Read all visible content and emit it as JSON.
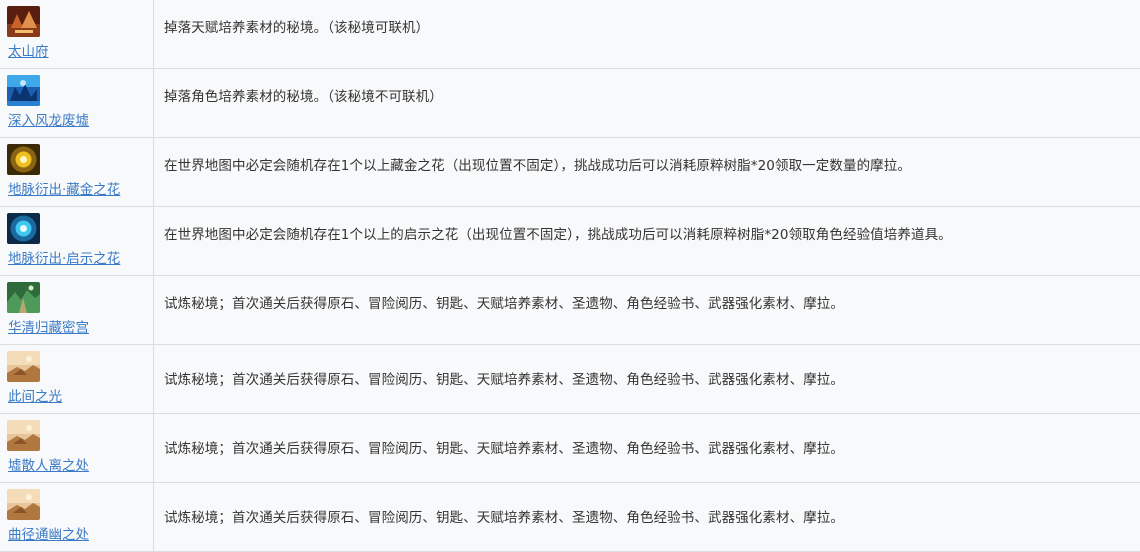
{
  "rows": [
    {
      "name": "太山府",
      "icon": "domain-icon-taishan",
      "desc": "掉落天赋培养素材的秘境。（该秘境可联机）"
    },
    {
      "name": "深入风龙废墟",
      "icon": "domain-icon-dragon-ruins",
      "desc": "掉落角色培养素材的秘境。（该秘境不可联机）"
    },
    {
      "name": "地脉衍出·藏金之花",
      "icon": "ley-line-gold-flower-icon",
      "desc": "在世界地图中必定会随机存在1个以上藏金之花（出现位置不固定），挑战成功后可以消耗原粹树脂*20领取一定数量的摩拉。"
    },
    {
      "name": "地脉衍出·启示之花",
      "icon": "ley-line-revelation-flower-icon",
      "desc": "在世界地图中必定会随机存在1个以上的启示之花（出现位置不固定），挑战成功后可以消耗原粹树脂*20领取角色经验值培养道具。"
    },
    {
      "name": "华清归藏密宫",
      "icon": "domain-icon-huaqing",
      "desc": "试炼秘境；首次通关后获得原石、冒险阅历、钥匙、天赋培养素材、圣遗物、角色经验书、武器强化素材、摩拉。"
    },
    {
      "name": "此间之光",
      "icon": "domain-icon-trial",
      "desc": "试炼秘境；首次通关后获得原石、冒险阅历、钥匙、天赋培养素材、圣遗物、角色经验书、武器强化素材、摩拉。"
    },
    {
      "name": "墟散人离之处",
      "icon": "domain-icon-trial",
      "desc": "试炼秘境；首次通关后获得原石、冒险阅历、钥匙、天赋培养素材、圣遗物、角色经验书、武器强化素材、摩拉。"
    },
    {
      "name": "曲径通幽之处",
      "icon": "domain-icon-trial",
      "desc": "试炼秘境；首次通关后获得原石、冒险阅历、钥匙、天赋培养素材、圣遗物、角色经验书、武器强化素材、摩拉。"
    }
  ],
  "colors": {
    "link": "#3b7ac6",
    "text": "#333333",
    "border": "#dcdcdc",
    "cell_bg": "#f8f9fa"
  }
}
